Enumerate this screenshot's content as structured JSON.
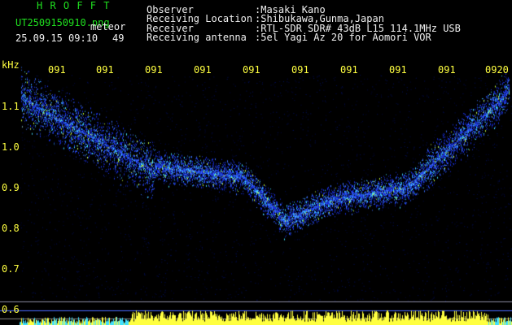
{
  "header": {
    "brand": "H R O F F T",
    "filename": "UT2509150910.png",
    "date_time": "25.09.15 09:10",
    "tag": "meteor",
    "count": "49",
    "fields": [
      {
        "label": "Observer",
        "value": ":Masaki Kano"
      },
      {
        "label": "Receiving Location",
        "value": ":Shibukawa,Gunma,Japan"
      },
      {
        "label": "Receiver",
        "value": ":RTL-SDR SDR# 43dB L15 114.1MHz USB"
      },
      {
        "label": "Receiving antenna",
        "value": ":5el Yagi Az 20 for Aomori VOR"
      }
    ]
  },
  "axes": {
    "unit": "kHz",
    "y_labels": [
      "1.1",
      "1.0",
      "0.9",
      "0.8",
      "0.7",
      "0.6"
    ],
    "x_labels": [
      "091",
      "091",
      "091",
      "091",
      "091",
      "091",
      "091",
      "091",
      "091",
      "0920"
    ]
  },
  "colors": {
    "background": "#000000",
    "header_green": "#1fe01f",
    "label_yellow": "#ffff40",
    "signal_blue": "#2040ff",
    "signal_cyan": "#40e0ff",
    "signal_yellow": "#ffff40"
  }
}
